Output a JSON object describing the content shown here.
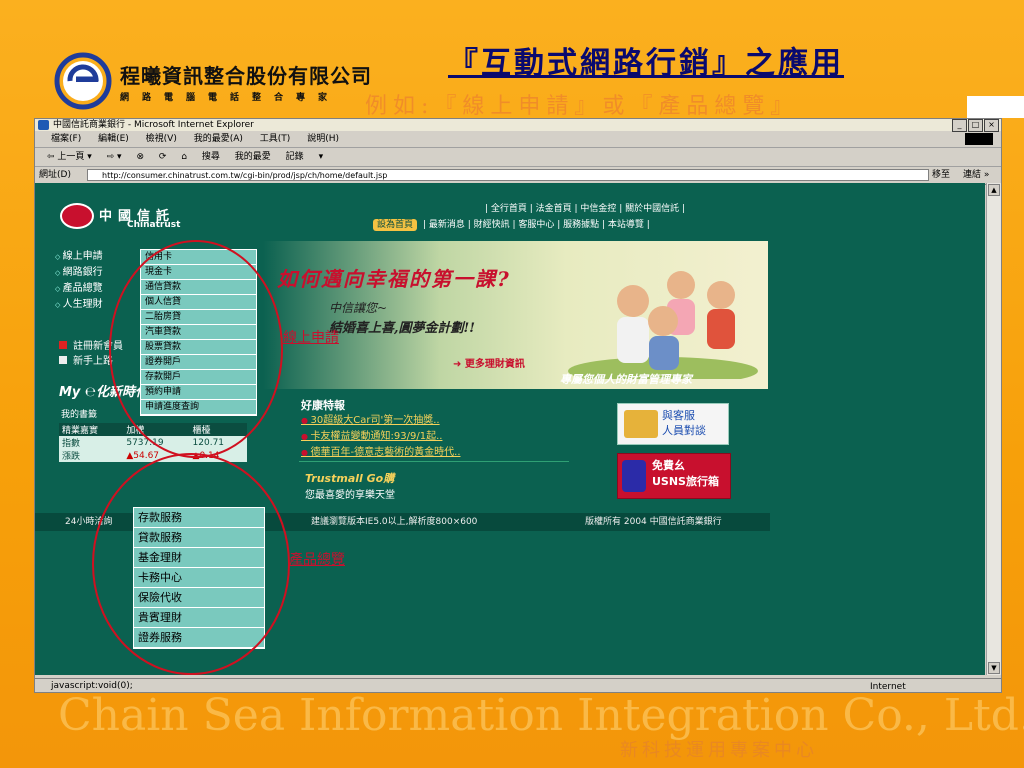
{
  "slide": {
    "company_name": "程曦資訊整合股份有限公司",
    "company_sub": "網路電腦電話整合專家",
    "title": "『互動式網路行銷』之應用",
    "subtitle": "例如:『線上申請』或『產品總覽』",
    "watermark": "Chain Sea Information Integration Co., Ltd.",
    "department": "新科技運用專案中心",
    "annotation_online": "線上申請",
    "annotation_products": "產品總覽"
  },
  "browser": {
    "title": "中國信託商業銀行 - Microsoft Internet Explorer",
    "menu": [
      "檔案(F)",
      "編輯(E)",
      "檢視(V)",
      "我的最愛(A)",
      "工具(T)",
      "說明(H)"
    ],
    "toolbar": [
      "⇦ 上一頁 ▾",
      "⇨ ▾",
      "⊗",
      "⟳",
      "⌂",
      "搜尋",
      "我的最愛",
      "記錄",
      "▾"
    ],
    "address_label": "網址(D)",
    "address": "http://consumer.chinatrust.com.tw/cgi-bin/prod/jsp/ch/home/default.jsp",
    "go_label": "移至",
    "links_label": "連結 »",
    "status": "javascript:void(0);",
    "zone": "Internet"
  },
  "site": {
    "brand_cn": "中國信託",
    "brand_en": "Chinatrust",
    "topnav1": "| 全行首頁 | 法金首頁 | 中信金控 | 關於中國信託 |",
    "home_btn": "設為首頁",
    "topnav2": "| 最新消息 | 財經快訊 | 客服中心 | 服務據點 | 本站導覽 |",
    "left_menu": [
      "線上申請",
      "網路銀行",
      "產品總覽",
      "人生理財"
    ],
    "left_links": [
      "註冊新會員",
      "新手上路"
    ],
    "my_ct": "My ℮化新時代",
    "my_doc": "我的書籤",
    "stock_head": [
      "精業嘉實",
      "加權",
      "櫃檯"
    ],
    "stock_rows": [
      [
        "指數",
        "5737.19",
        "120.71"
      ],
      [
        "漲跌",
        "▲54.67",
        "▲0.14"
      ]
    ],
    "dropdown_online": [
      "信用卡",
      "現金卡",
      "通信貸款",
      "個人信貸",
      "二胎房貸",
      "汽車貸款",
      "股票貸款",
      "證券開戶",
      "存款開戶",
      "預約申請",
      "申請進度查詢"
    ],
    "banner_title": "如何邁向幸福的第一課?",
    "banner_line1": "中信讓您~",
    "banner_line2": "結婚喜上喜,圓夢金計劃!!",
    "banner_more": "➜ 更多理財資訊",
    "banner_caption": "專屬您個人的財富管理專家",
    "promo_title": "好康特報",
    "promo_items": [
      "30超級大Car司'第一次抽獎..",
      "卡友權益變動通知:93/9/1起..",
      "德華百年-德意志藝術的黃金時代.."
    ],
    "trustmall_logo": "Trustmall Go購",
    "trustmall_tag": "您最喜愛的享樂天堂",
    "cs_text": [
      "與客服",
      "人員對談"
    ],
    "usns_text": [
      "免費幺",
      "USNS旅行箱"
    ],
    "footer": [
      "24小時洽詢",
      "建議瀏覽版本IE5.0以上,解析度800×600",
      "版權所有 2004 中國信託商業銀行"
    ],
    "dropdown_products": [
      "存款服務",
      "貸款服務",
      "基金理財",
      "卡務中心",
      "保險代收",
      "貴賓理財",
      "證券服務"
    ]
  },
  "colors": {
    "slide_bg": "#F9A30C",
    "title": "#0A0A6E",
    "site_bg": "#0B6150",
    "menu_bg": "#7AC9BE",
    "annotation": "#C8102E"
  }
}
